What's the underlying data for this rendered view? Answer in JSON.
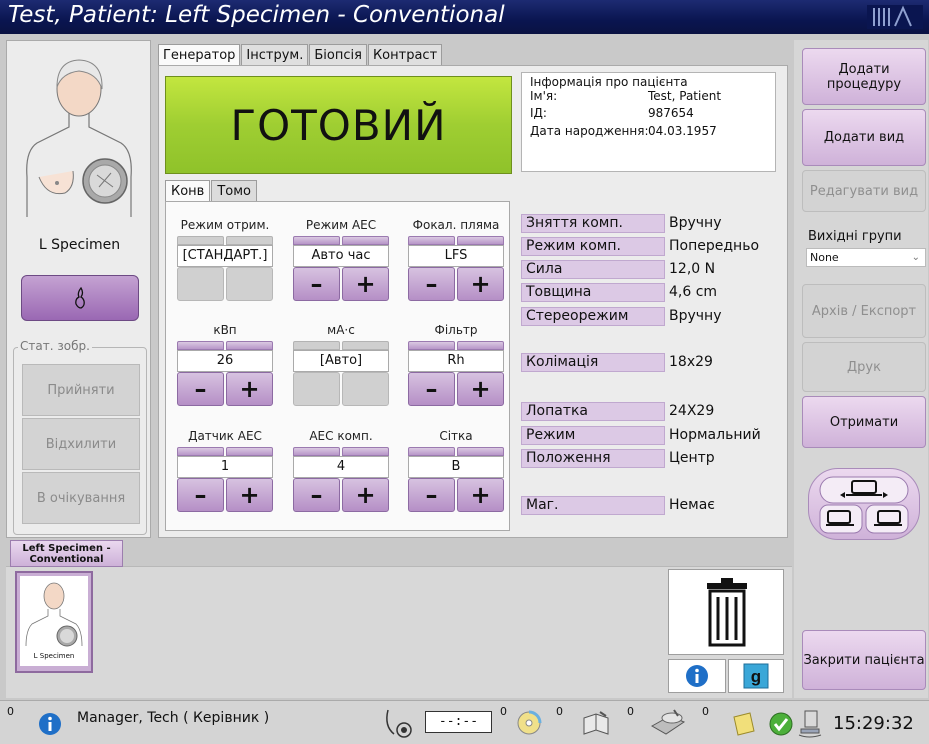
{
  "window": {
    "title": "Test, Patient:  Left Specimen - Conventional"
  },
  "left": {
    "view_label": "L Specimen",
    "stat_group_title": "Стат. зобр.",
    "accept": "Прийняти",
    "reject": "Відхилити",
    "pending": "В очікування"
  },
  "tabs": [
    "Генератор",
    "Інструм.",
    "Біопсія",
    "Контраст"
  ],
  "status_text": "ГОТОВИЙ",
  "patient_info": {
    "title": "Інформація про пацієнта",
    "name_label": "Ім'я:",
    "name": "Test, Patient",
    "id_label": "ІД:",
    "id": "987654",
    "dob_label": "Дата народження:",
    "dob": "04.03.1957"
  },
  "subtabs": [
    "Конв",
    "Томо"
  ],
  "params": {
    "mode": {
      "label": "Режим отрим.",
      "value": "[СТАНДАРТ.]"
    },
    "aec_mode": {
      "label": "Режим AEC",
      "value": "Авто час"
    },
    "focal": {
      "label": "Фокал. пляма",
      "value": "LFS"
    },
    "kv": {
      "label": "кВп",
      "value": "26"
    },
    "mas": {
      "label": "мА·с",
      "value": "[Авто]"
    },
    "filter": {
      "label": "Фільтр",
      "value": "Rh"
    },
    "aec_sensor": {
      "label": "Датчик AEC",
      "value": "1"
    },
    "aec_comp": {
      "label": "AEC комп.",
      "value": "4"
    },
    "grid": {
      "label": "Сітка",
      "value": "B"
    },
    "minus": "–",
    "plus": "+"
  },
  "settings": {
    "decompression": {
      "k": "Зняття комп.",
      "v": "Вручну"
    },
    "comp_mode": {
      "k": "Режим комп.",
      "v": "Попередньо"
    },
    "force": {
      "k": "Сила",
      "v": "12,0 N"
    },
    "thickness": {
      "k": "Товщина",
      "v": "4,6 cm"
    },
    "stereo": {
      "k": "Стереорежим",
      "v": "Вручну"
    },
    "collimation": {
      "k": "Колімація",
      "v": "18x29"
    },
    "paddle": {
      "k": "Лопатка",
      "v": "24X29"
    },
    "mode": {
      "k": "Режим",
      "v": "Нормальний"
    },
    "position": {
      "k": "Положення",
      "v": "Центр"
    },
    "mag": {
      "k": "Маг.",
      "v": "Немає"
    }
  },
  "right": {
    "add_procedure": "Додати процедуру",
    "add_view": "Додати вид",
    "edit_view": "Редагувати вид",
    "output_groups": "Вихідні групи",
    "output_select": "None",
    "archive": "Архів / Експорт",
    "print": "Друк",
    "retrieve": "Отримати",
    "close_patient": "Закрити пацієнта"
  },
  "thumbnail": {
    "tab_label": "Left Specimen - Conventional",
    "caption": "L Specimen"
  },
  "statusbar": {
    "alarm_count": "0",
    "user": "Manager, Tech ( Керівник )",
    "timer": "--:--",
    "count_timer": "0",
    "count_cd": "0",
    "count_book": "0",
    "count_disc": "0",
    "time": "15:29:32"
  },
  "colors": {
    "ready_green": "#a6d334",
    "accent_purple": "#b58fc6",
    "title_blue": "#0a1550"
  }
}
